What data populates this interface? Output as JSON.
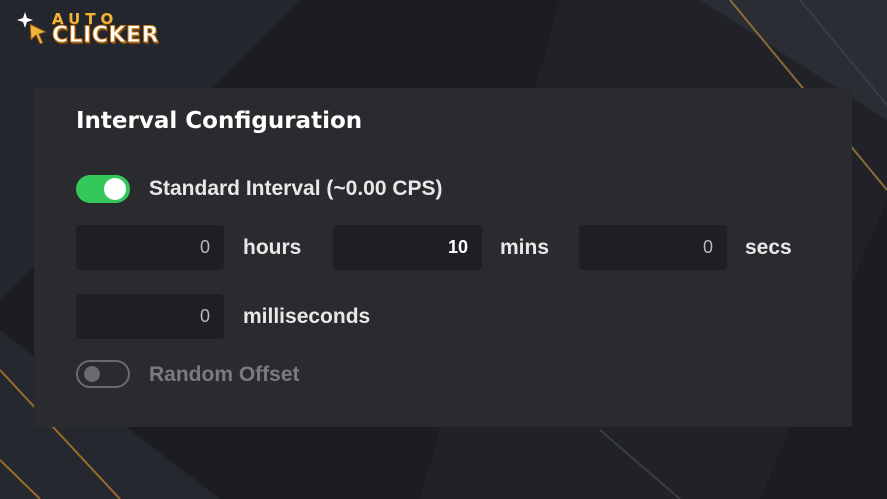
{
  "app": {
    "logo_top": "AUTO",
    "logo_bottom": "CLICKER"
  },
  "colors": {
    "accent_green": "#34c759",
    "panel_bg": "#2a2b2e",
    "field_bg": "#1e1f22",
    "logo_gold": "#f2b33a"
  },
  "panel": {
    "title": "Interval Configuration",
    "standard_interval": {
      "enabled": true,
      "label": "Standard Interval (~0.00 CPS)"
    },
    "fields": {
      "hours": {
        "value": "0",
        "unit": "hours"
      },
      "mins": {
        "value": "10",
        "unit": "mins"
      },
      "secs": {
        "value": "0",
        "unit": "secs"
      },
      "milliseconds": {
        "value": "0",
        "unit": "milliseconds"
      }
    },
    "random_offset": {
      "enabled": false,
      "label": "Random Offset"
    }
  },
  "icons": {
    "logo": "sparkle-cursor-icon"
  }
}
